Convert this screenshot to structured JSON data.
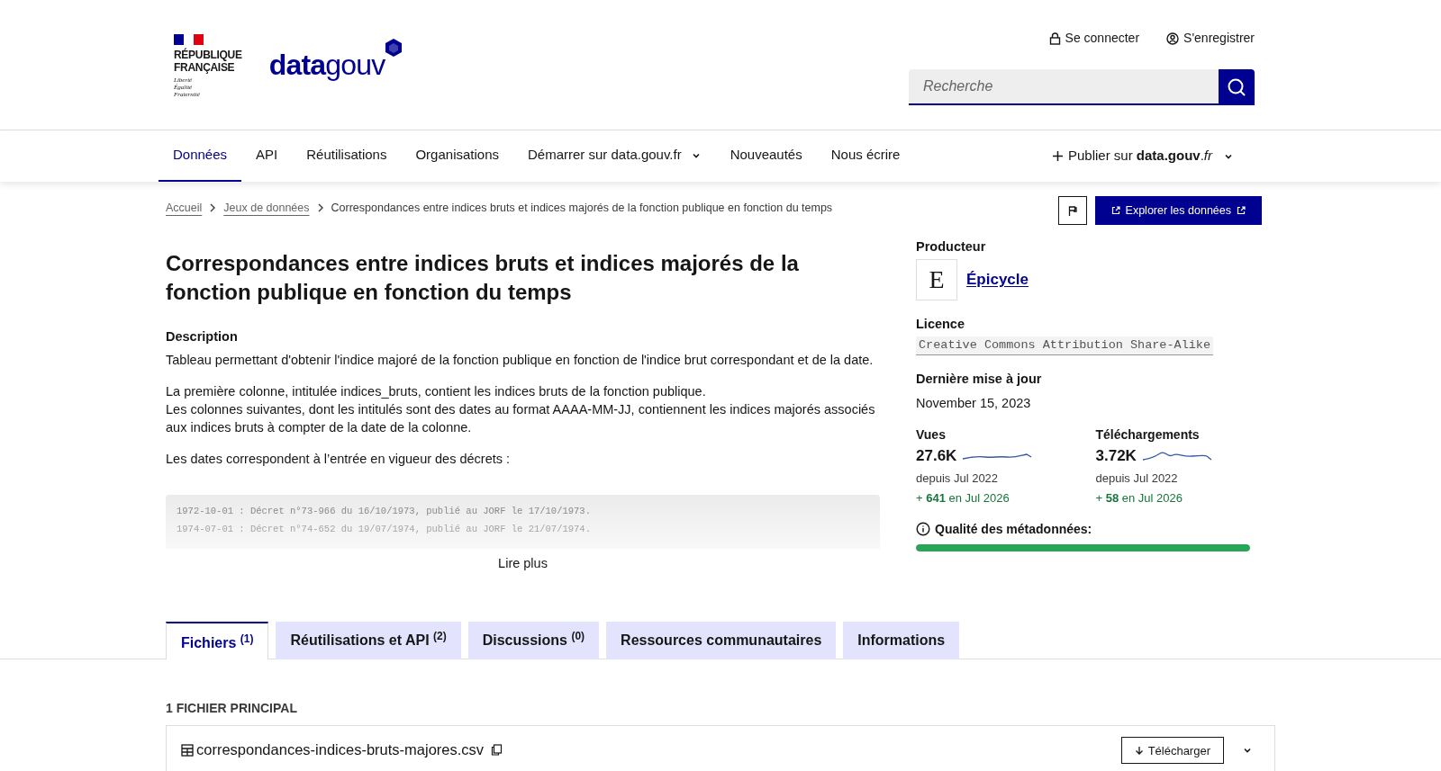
{
  "header": {
    "republic": {
      "name_lines": [
        "RÉPUBLIQUE",
        "FRANÇAISE"
      ],
      "motto_lines": [
        "Liberté",
        "Égalité",
        "Fraternité"
      ]
    },
    "brand": {
      "bold": "data",
      "light": "gouv"
    },
    "account_links": [
      {
        "kind": "login",
        "label": "Se connecter"
      },
      {
        "kind": "register",
        "label": "S'enregistrer"
      }
    ],
    "search": {
      "placeholder": "Recherche"
    }
  },
  "nav": {
    "items": [
      {
        "label": "Données",
        "selected": true,
        "dropdown": false
      },
      {
        "label": "API",
        "selected": false,
        "dropdown": false
      },
      {
        "label": "Réutilisations",
        "selected": false,
        "dropdown": false
      },
      {
        "label": "Organisations",
        "selected": false,
        "dropdown": false
      },
      {
        "label": "Démarrer sur data.gouv.fr",
        "selected": false,
        "dropdown": true
      },
      {
        "label": "Nouveautés",
        "selected": false,
        "dropdown": false
      },
      {
        "label": "Nous écrire",
        "selected": false,
        "dropdown": false
      }
    ],
    "publish": "Publier sur **data.gouv**.*fr*"
  },
  "breadcrumb": [
    {
      "label": "Accueil",
      "link": true
    },
    {
      "label": "Jeux de données",
      "link": true
    },
    {
      "label": "Correspondances entre indices bruts et indices majorés de la fonction publique en fonction du temps",
      "link": false
    }
  ],
  "actions": {
    "explore": "Explorer les données"
  },
  "dataset": {
    "title": "Correspondances entre indices bruts et indices majorés de la fonction publique en fonction du temps",
    "description_label": "Description",
    "paragraphs": [
      [
        "Tableau permettant d'obtenir l'indice majoré de la fonction publique en fonction de l'indice brut correspondant et de la date."
      ],
      [
        "La première colonne, intitulée indices_bruts, contient les indices bruts de la fonction publique.",
        "Les colonnes suivantes, dont les intitulés sont des dates au format AAAA-MM-JJ, contiennent les indices majorés associés aux indices bruts à compter de la date de la colonne."
      ],
      [
        "Les dates correspondent à l’entrée en vigueur des décrets :"
      ]
    ],
    "code_lines": [
      "1972-10-01 : Décret n°73-966 du 16/10/1973, publié au JORF le 17/10/1973.",
      "1974-07-01 : Décret n°74-652 du 19/07/1974, publié au JORF le 21/07/1974."
    ],
    "read_more": "Lire plus"
  },
  "sidebar": {
    "producer_label": "Producteur",
    "producer_logo": "E",
    "producer": "Épicycle",
    "license_label": "Licence",
    "license": "Creative Commons Attribution Share-Alike",
    "updated_label": "Dernière mise à jour",
    "updated": "November 15, 2023",
    "stats": [
      {
        "label": "Vues",
        "value": "27.6K",
        "since": "depuis Jul 2022",
        "delta": "+ **641** en Jul 2026"
      },
      {
        "label": "Téléchargements",
        "value": "3.72K",
        "since": "depuis Jul 2022",
        "delta": "+ **58** en Jul 2026"
      }
    ],
    "quality": {
      "label": "Qualité des métadonnées:",
      "level": 1
    }
  },
  "tabs": [
    {
      "label": "Fichiers $^{(1)}$",
      "selected": true
    },
    {
      "label": "Réutilisations et API $^{(2)}$",
      "selected": false
    },
    {
      "label": "Discussions $^{(0)}$",
      "selected": false
    },
    {
      "label": "Ressources communautaires",
      "selected": false
    },
    {
      "label": "Informations",
      "selected": false
    }
  ],
  "files": {
    "heading": "1 FICHIER PRINCIPAL",
    "items": [
      {
        "name": "correspondances-indices-bruts-majores.csv",
        "download": "Télécharger"
      }
    ]
  }
}
